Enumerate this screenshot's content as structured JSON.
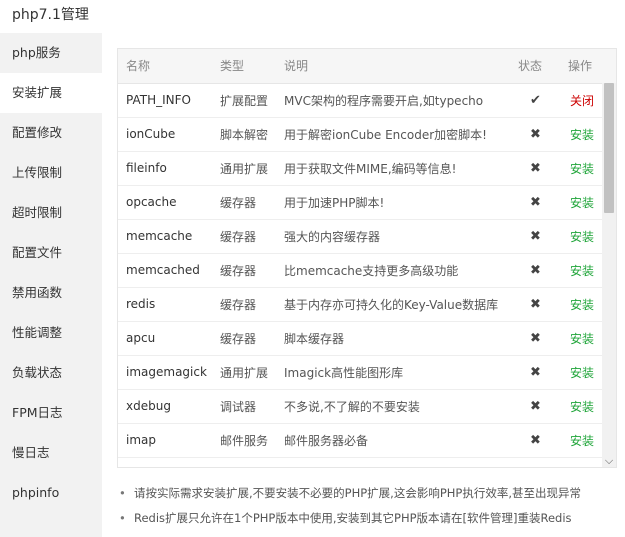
{
  "window": {
    "title": "php7.1管理"
  },
  "sidebar": {
    "items": [
      {
        "label": "php服务"
      },
      {
        "label": "安装扩展"
      },
      {
        "label": "配置修改"
      },
      {
        "label": "上传限制"
      },
      {
        "label": "超时限制"
      },
      {
        "label": "配置文件"
      },
      {
        "label": "禁用函数"
      },
      {
        "label": "性能调整"
      },
      {
        "label": "负载状态"
      },
      {
        "label": "FPM日志"
      },
      {
        "label": "慢日志"
      },
      {
        "label": "phpinfo"
      }
    ],
    "active_index": 1
  },
  "table": {
    "headers": {
      "name": "名称",
      "type": "类型",
      "desc": "说明",
      "status": "状态",
      "op": "操作"
    },
    "rows": [
      {
        "name": "PATH_INFO",
        "type": "扩展配置",
        "desc": "MVC架构的程序需要开启,如typecho",
        "status": "✔",
        "op": "关闭"
      },
      {
        "name": "ionCube",
        "type": "脚本解密",
        "desc": "用于解密ionCube Encoder加密脚本!",
        "status": "✖",
        "op": "安装"
      },
      {
        "name": "fileinfo",
        "type": "通用扩展",
        "desc": "用于获取文件MIME,编码等信息!",
        "status": "✖",
        "op": "安装"
      },
      {
        "name": "opcache",
        "type": "缓存器",
        "desc": "用于加速PHP脚本!",
        "status": "✖",
        "op": "安装"
      },
      {
        "name": "memcache",
        "type": "缓存器",
        "desc": "强大的内容缓存器",
        "status": "✖",
        "op": "安装"
      },
      {
        "name": "memcached",
        "type": "缓存器",
        "desc": "比memcache支持更多高级功能",
        "status": "✖",
        "op": "安装"
      },
      {
        "name": "redis",
        "type": "缓存器",
        "desc": "基于内存亦可持久化的Key-Value数据库",
        "status": "✖",
        "op": "安装"
      },
      {
        "name": "apcu",
        "type": "缓存器",
        "desc": "脚本缓存器",
        "status": "✖",
        "op": "安装"
      },
      {
        "name": "imagemagick",
        "type": "通用扩展",
        "desc": "Imagick高性能图形库",
        "status": "✖",
        "op": "安装"
      },
      {
        "name": "xdebug",
        "type": "调试器",
        "desc": "不多说,不了解的不要安装",
        "status": "✖",
        "op": "安装"
      },
      {
        "name": "imap",
        "type": "邮件服务",
        "desc": "邮件服务器必备",
        "status": "✖",
        "op": "安装"
      }
    ]
  },
  "notes": [
    "请按实际需求安装扩展,不要安装不必要的PHP扩展,这会影响PHP执行效率,甚至出现异常",
    "Redis扩展只允许在1个PHP版本中使用,安装到其它PHP版本请在[软件管理]重装Redis"
  ],
  "colors": {
    "install": "#20a53a",
    "close": "#cc0000",
    "sidebar_bg": "#f2f2f2"
  },
  "icons": {
    "enabled": "check-icon",
    "disabled": "cross-icon",
    "scroll_down": "chevron-down-icon"
  }
}
